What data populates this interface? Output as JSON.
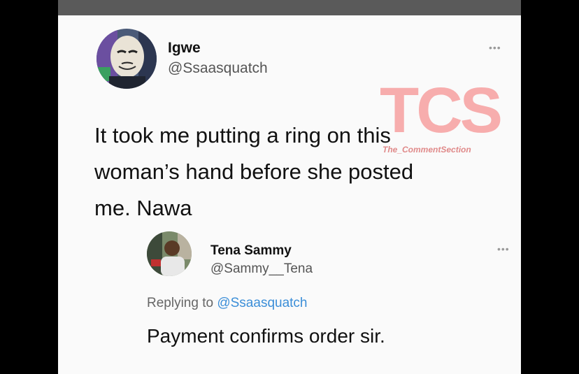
{
  "tweet": {
    "author_name": "Igwe",
    "author_handle": "@Ssaasquatch",
    "more": "•••",
    "text": "It took me putting a ring on this\nwoman’s hand before she posted\nme. Nawa"
  },
  "reply": {
    "author_name": "Tena Sammy",
    "author_handle": "@Sammy__Tena",
    "more": "•••",
    "replying_prefix": "Replying to",
    "replying_handle": "@Ssaasquatch",
    "text": "Payment confirms order sir."
  },
  "watermark": {
    "logo": "TCS",
    "subtitle": "The_CommentSection",
    "color": "#f08080"
  },
  "icons": {
    "avatar_1": "guy-fawkes-mask-avatar",
    "avatar_2": "man-photo-avatar",
    "more": "more-dots-icon"
  }
}
